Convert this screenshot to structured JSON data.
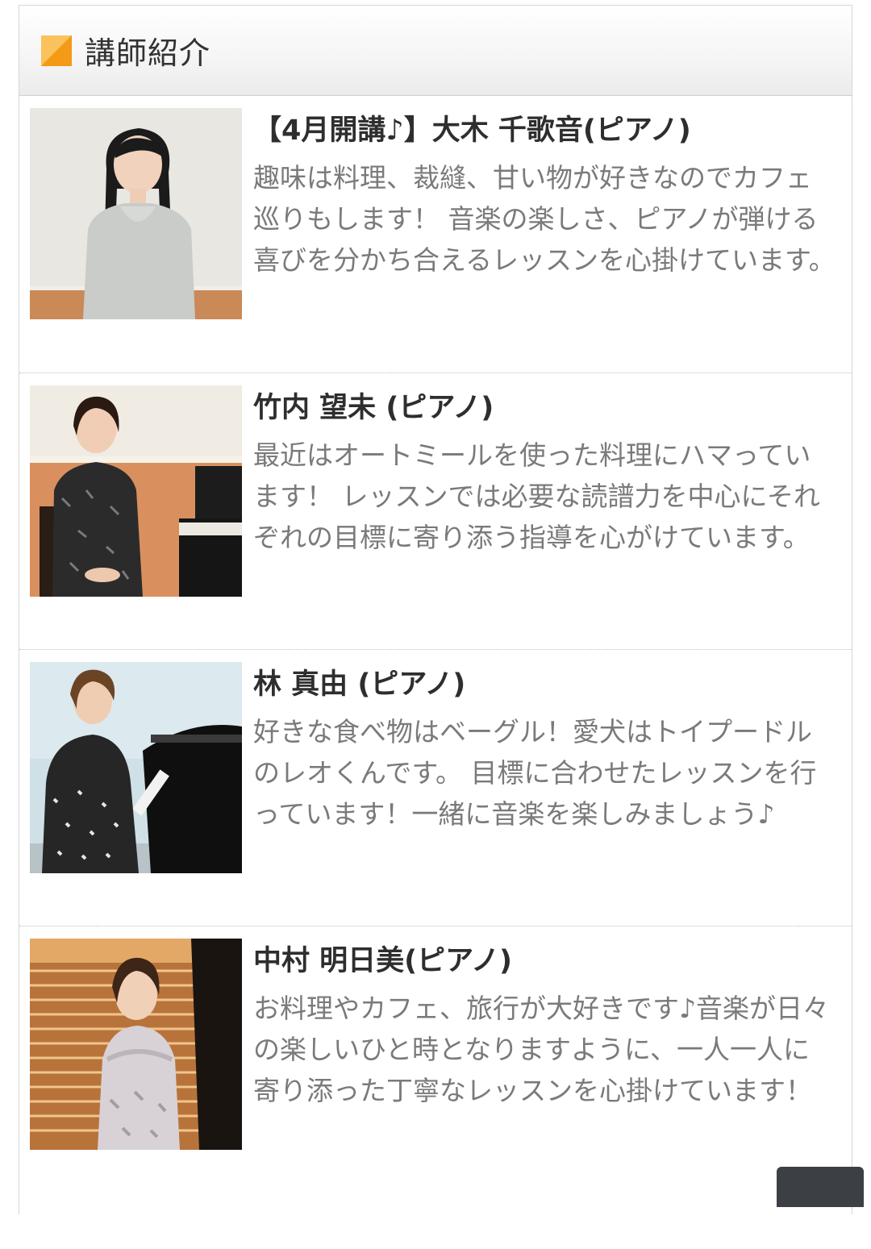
{
  "section": {
    "title": "講師紹介",
    "header_icon": "orange-square-icon",
    "accent_color": "#f39a17"
  },
  "teachers": [
    {
      "name": "【4月開講♪】大木 千歌音(ピアノ)",
      "description": "趣味は料理、裁縫、甘い物が好きなのでカフェ巡りもします！ 音楽の楽しさ、ピアノが弾ける喜びを分かち合えるレッスンを心掛けています。"
    },
    {
      "name": "竹内 望未 (ピアノ)",
      "description": "最近はオートミールを使った料理にハマっています！ レッスンでは必要な読譜力を中心にそれぞれの目標に寄り添う指導を心がけています。"
    },
    {
      "name": "林 真由 (ピアノ)",
      "description": "好きな食べ物はベーグル！愛犬はトイプードルのレオくんです。 目標に合わせたレッスンを行っています！一緒に音楽を楽しみましょう♪"
    },
    {
      "name": "中村 明日美(ピアノ)",
      "description": "お料理やカフェ、旅行が大好きです♪音楽が日々の楽しいひと時となりますように、一人一人に寄り添った丁寧なレッスンを心掛けています！"
    }
  ]
}
